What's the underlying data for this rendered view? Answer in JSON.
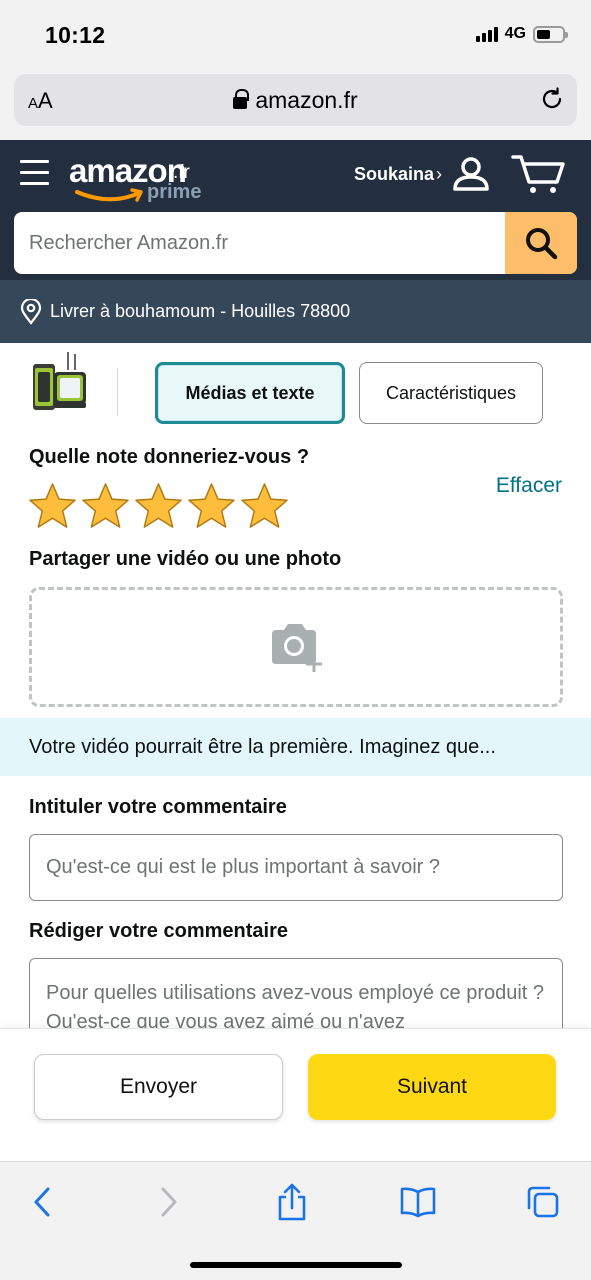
{
  "status_bar": {
    "time": "10:12",
    "network": "4G",
    "battery_fraction": 0.55
  },
  "browser": {
    "text_size_label_small": "A",
    "text_size_label_large": "A",
    "url": "amazon.fr"
  },
  "header": {
    "logo_word": "amazon",
    "logo_tld": ".fr",
    "logo_sub": "prime",
    "account_name": "Soukaina",
    "account_chevron": "›",
    "search_placeholder": "Rechercher Amazon.fr",
    "deliver_to": "Livrer à bouhamoum - Houilles 78800"
  },
  "tabs": [
    {
      "label": "Médias et texte",
      "selected": true
    },
    {
      "label": "Caractéristiques",
      "selected": false
    }
  ],
  "rating": {
    "question": "Quelle note donneriez-vous ?",
    "clear_label": "Effacer",
    "stars_filled": 5,
    "stars_total": 5,
    "star_color": "#febd3b"
  },
  "media": {
    "question": "Partager une vidéo ou une photo",
    "banner_text": "Votre vidéo pourrait être la première. Imaginez que..."
  },
  "review_title": {
    "label": "Intituler votre commentaire",
    "placeholder": "Qu'est-ce qui est le plus important à savoir ?"
  },
  "review_body": {
    "label": "Rédiger votre commentaire",
    "placeholder": "Pour quelles utilisations avez-vous employé ce produit ? Qu'est-ce que vous avez aimé ou n'avez"
  },
  "actions": {
    "send_label": "Envoyer",
    "next_label": "Suivant",
    "next_color": "#ffd814"
  },
  "icons": [
    "signal-icon",
    "battery-icon",
    "lock-icon",
    "reload-icon",
    "menu-icon",
    "user-icon",
    "cart-icon",
    "search-icon",
    "location-pin-icon",
    "camera-add-icon",
    "back-icon",
    "forward-icon",
    "share-icon",
    "bookmarks-icon",
    "tabs-icon"
  ]
}
